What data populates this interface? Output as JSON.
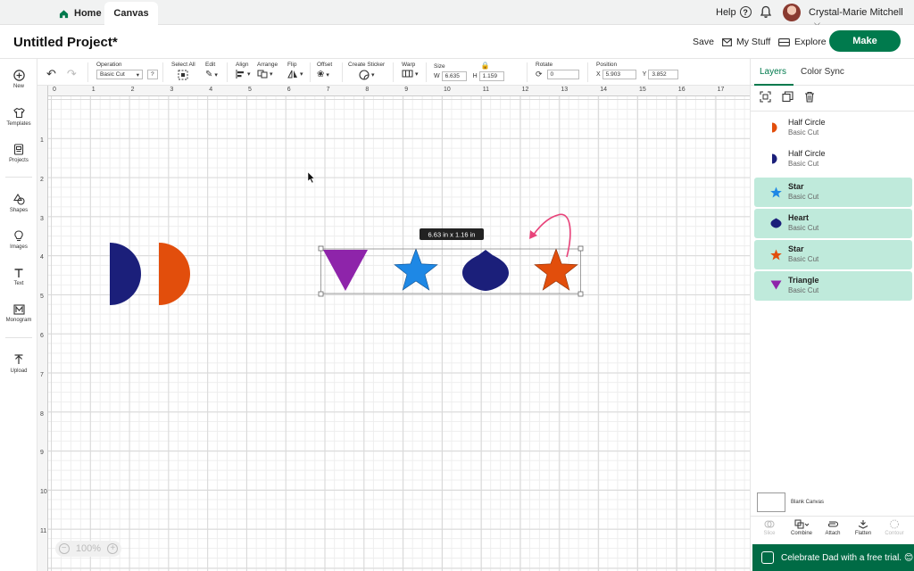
{
  "topbar": {
    "home_label": "Home",
    "canvas_label": "Canvas",
    "help_label": "Help",
    "help_glyph": "?",
    "user_name": "Crystal-Marie Mitchell"
  },
  "header": {
    "project_title": "Untitled Project*",
    "save_label": "Save",
    "mystuff_label": "My Stuff",
    "explore_label": "Explore",
    "make_label": "Make",
    "make_color": "#007a4d"
  },
  "toolbar": {
    "operation_label": "Operation",
    "operation_value": "Basic Cut",
    "operation_help": "?",
    "select_all_label": "Select All",
    "edit_label": "Edit",
    "align_label": "Align",
    "arrange_label": "Arrange",
    "flip_label": "Flip",
    "offset_label": "Offset",
    "create_sticker_label": "Create Sticker",
    "warp_label": "Warp",
    "size_label": "Size",
    "size_w_label": "W",
    "size_w_value": "6.635",
    "size_h_label": "H",
    "size_h_value": "1.159",
    "rotate_label": "Rotate",
    "rotate_value": "0",
    "position_label": "Position",
    "position_x_label": "X",
    "position_x_value": "5.903",
    "position_y_label": "Y",
    "position_y_value": "3.852"
  },
  "leftbar": {
    "items": [
      {
        "label": "New",
        "icon": "plus-circle-icon"
      },
      {
        "label": "Templates",
        "icon": "shirt-icon"
      },
      {
        "label": "Projects",
        "icon": "projects-icon"
      },
      {
        "label": "Shapes",
        "icon": "shapes-icon"
      },
      {
        "label": "Images",
        "icon": "lightbulb-icon"
      },
      {
        "label": "Text",
        "icon": "text-icon"
      },
      {
        "label": "Monogram",
        "icon": "monogram-icon"
      },
      {
        "label": "Upload",
        "icon": "upload-icon"
      }
    ]
  },
  "canvas": {
    "ruler_top": [
      "0",
      "1",
      "2",
      "3",
      "4",
      "5",
      "6",
      "7",
      "8",
      "9",
      "10",
      "11",
      "12",
      "13",
      "14",
      "15",
      "16",
      "17"
    ],
    "ruler_left": [
      "1",
      "2",
      "3",
      "4",
      "5",
      "6",
      "7",
      "8",
      "9",
      "10",
      "11"
    ],
    "size_tooltip": "6.63  in x 1.16  in",
    "zoom_value": "100%",
    "shape_colors": {
      "navy": "#1b1f7a",
      "orange": "#e24e0c",
      "purple": "#8e24aa",
      "blue": "#1e88e5",
      "arrow": "#e8437a"
    }
  },
  "rightpanel": {
    "tabs": [
      {
        "label": "Layers",
        "active": true
      },
      {
        "label": "Color Sync",
        "active": false
      }
    ],
    "layers": [
      {
        "name": "Half Circle",
        "operation": "Basic Cut",
        "icon": "half-circle-icon",
        "color": "#e24e0c",
        "selected": false
      },
      {
        "name": "Half Circle",
        "operation": "Basic Cut",
        "icon": "half-circle-icon",
        "color": "#1b1f7a",
        "selected": false
      },
      {
        "name": "Star",
        "operation": "Basic Cut",
        "icon": "star-icon",
        "color": "#1e88e5",
        "selected": true
      },
      {
        "name": "Heart",
        "operation": "Basic Cut",
        "icon": "heart-icon",
        "color": "#1b1f7a",
        "selected": true
      },
      {
        "name": "Star",
        "operation": "Basic Cut",
        "icon": "star-icon",
        "color": "#e24e0c",
        "selected": true
      },
      {
        "name": "Triangle",
        "operation": "Basic Cut",
        "icon": "triangle-icon",
        "color": "#8e24aa",
        "selected": true
      }
    ],
    "blank_canvas_label": "Blank Canvas",
    "bottom_actions": [
      {
        "label": "Slice",
        "enabled": false
      },
      {
        "label": "Combine",
        "enabled": true
      },
      {
        "label": "Attach",
        "enabled": true
      },
      {
        "label": "Flatten",
        "enabled": true
      },
      {
        "label": "Contour",
        "enabled": false
      }
    ],
    "promo_text": "Celebrate Dad with a free trial. 😊"
  }
}
